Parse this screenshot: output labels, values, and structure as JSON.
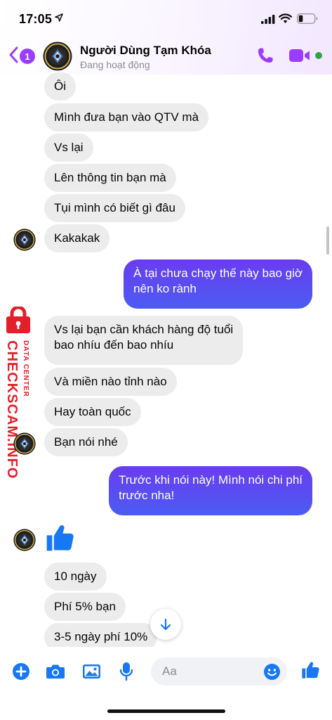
{
  "status_bar": {
    "time": "17:05"
  },
  "header": {
    "back_badge": "1",
    "name": "Người Dùng Tạm Khóa",
    "status": "Đang hoạt động"
  },
  "messages": [
    {
      "side": "in",
      "text": "Ôi"
    },
    {
      "side": "in",
      "text": "Mình đưa bạn vào QTV mà"
    },
    {
      "side": "in",
      "text": "Vs lại"
    },
    {
      "side": "in",
      "text": "Lên thông tin bạn mà"
    },
    {
      "side": "in",
      "text": "Tụi mình có biết gì đâu"
    },
    {
      "side": "in",
      "text": "Kakakak"
    },
    {
      "side": "out",
      "text": "À tại chưa chạy thế này bao giờ\nnên ko rành"
    },
    {
      "side": "in",
      "text": "Vs lại bạn cần khách hàng độ tuổi\nbao nhíu đến bao nhíu"
    },
    {
      "side": "in",
      "text": "Và miền nào tỉnh nào"
    },
    {
      "side": "in",
      "text": "Hay toàn quốc"
    },
    {
      "side": "in",
      "text": "Bạn nói nhé"
    },
    {
      "side": "out",
      "text": "Trước khi nói này! Mình nói chi phí\ntrước nha!"
    },
    {
      "side": "in",
      "text": "10 ngày"
    },
    {
      "side": "in",
      "text": "Phí 5% bạn"
    },
    {
      "side": "in",
      "text": "3-5 ngày phí 10%"
    }
  ],
  "watermark": {
    "brand": "CHECKSCAM.INFO",
    "sub": "DATA CENTER"
  },
  "composer": {
    "placeholder": "Aa"
  },
  "colors": {
    "accent": "#9b3dff",
    "bubble_in": "#ececec",
    "bubble_out_top": "#6a3cf0",
    "bubble_out_bottom": "#4b5cf2",
    "composer_icon": "#1877f2",
    "online": "#31a24c",
    "watermark": "#e3202a"
  },
  "icons": {
    "header": [
      "back-arrow-icon",
      "phone-icon",
      "video-camera-icon"
    ],
    "composer": [
      "plus-icon",
      "camera-icon",
      "image-icon",
      "microphone-icon",
      "emoji-icon",
      "thumbs-up-icon"
    ],
    "thread": [
      "thumbs-up-icon",
      "arrow-down-icon"
    ]
  }
}
